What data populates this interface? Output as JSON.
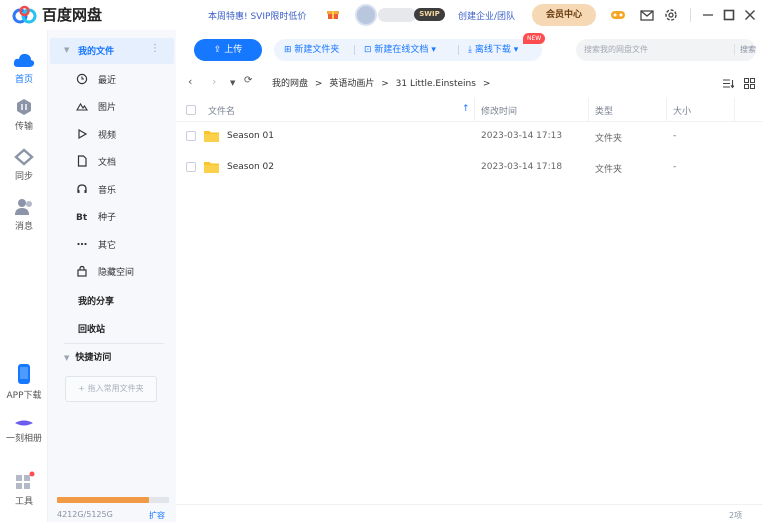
{
  "app": {
    "title": "百度网盘"
  },
  "topbar": {
    "promo": "本周特惠! SVIP限时低价",
    "svip_badge": "SWIP",
    "corp_link": "创建企业/团队",
    "member_button": "会员中心"
  },
  "rail": {
    "items": [
      {
        "label": "首页",
        "icon": "cloud-icon"
      },
      {
        "label": "传输",
        "icon": "transfer-icon"
      },
      {
        "label": "同步",
        "icon": "sync-icon"
      },
      {
        "label": "消息",
        "icon": "message-icon"
      },
      {
        "label": "APP下载",
        "icon": "phone-icon"
      },
      {
        "label": "一刻相册",
        "icon": "album-icon"
      },
      {
        "label": "工具",
        "icon": "tools-icon"
      }
    ]
  },
  "sidebar": {
    "my_files": "我的文件",
    "items": [
      {
        "label": "最近",
        "icon": "clock-icon"
      },
      {
        "label": "图片",
        "icon": "image-icon"
      },
      {
        "label": "视频",
        "icon": "video-icon"
      },
      {
        "label": "文档",
        "icon": "document-icon"
      },
      {
        "label": "音乐",
        "icon": "headphones-icon"
      },
      {
        "label": "种子",
        "icon": "bt-icon"
      },
      {
        "label": "其它",
        "icon": "more-icon"
      },
      {
        "label": "隐藏空间",
        "icon": "lock-icon"
      }
    ],
    "my_share": "我的分享",
    "recycle": "回收站",
    "quick_access": "快捷访问",
    "drag_hint": "+ 拖入常用文件夹",
    "quota_text": "4212G/5125G",
    "quota_used_fraction": 0.822,
    "expand": "扩容"
  },
  "toolbar": {
    "upload": "上传",
    "new_folder": "新建文件夹",
    "new_online_doc": "新建在线文档",
    "new_badge": "NEW",
    "offline_download": "离线下载",
    "search_placeholder": "搜索我的网盘文件",
    "search_button": "搜索"
  },
  "breadcrumb": {
    "items": [
      "我的网盘",
      "英语动画片",
      "31 Little.Einsteins"
    ],
    "separator": ">"
  },
  "table": {
    "headers": {
      "name": "文件名",
      "modified": "修改时间",
      "type": "类型",
      "size": "大小"
    },
    "rows": [
      {
        "name": "Season 01",
        "modified": "2023-03-14 17:13",
        "type": "文件夹",
        "size": "-"
      },
      {
        "name": "Season 02",
        "modified": "2023-03-14 17:18",
        "type": "文件夹",
        "size": "-"
      }
    ]
  },
  "footer": {
    "count": "2项"
  },
  "colors": {
    "accent": "#1677ff",
    "folder": "#f9c52a",
    "quota": "#f29b47"
  }
}
